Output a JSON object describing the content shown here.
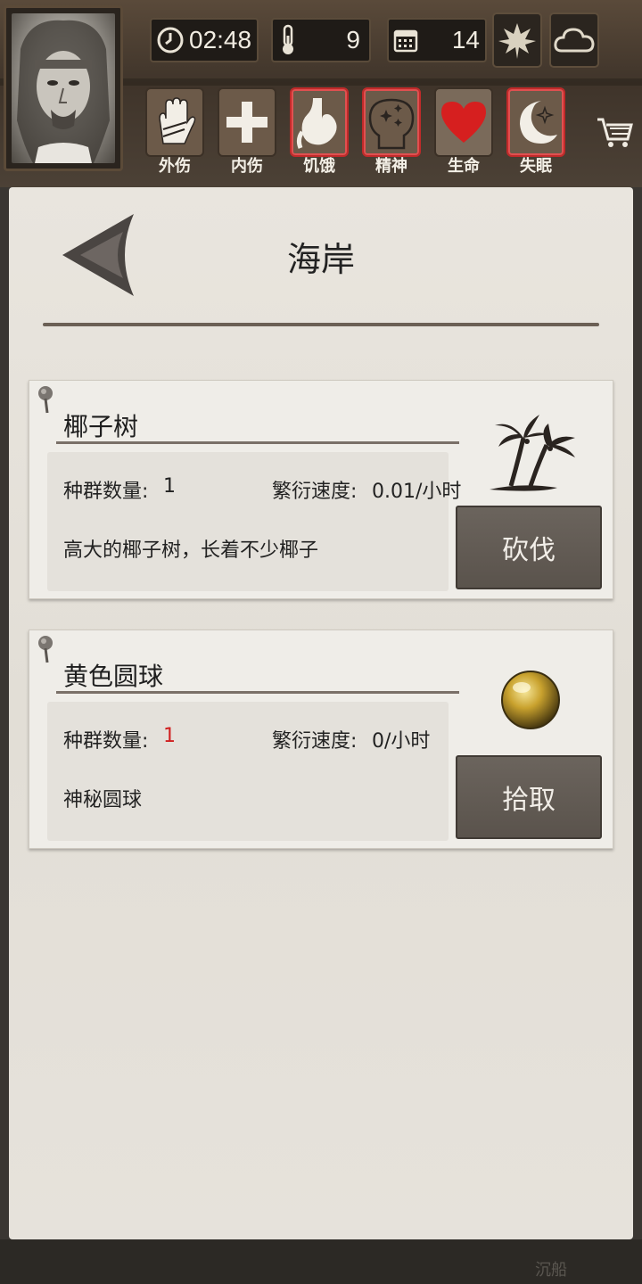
{
  "hud": {
    "time": "02:48",
    "temperature": "9",
    "day": "14"
  },
  "status": [
    {
      "label": "外伤",
      "icon": "hand-icon",
      "alert": false
    },
    {
      "label": "内伤",
      "icon": "cross-icon",
      "alert": false
    },
    {
      "label": "饥饿",
      "icon": "stomach-icon",
      "alert": true
    },
    {
      "label": "精神",
      "icon": "head-sparkle-icon",
      "alert": true
    },
    {
      "label": "生命",
      "icon": "heart-icon",
      "alert": false
    },
    {
      "label": "失眠",
      "icon": "moon-star-icon",
      "alert": true
    }
  ],
  "page": {
    "title": "海岸"
  },
  "resources": [
    {
      "name": "椰子树",
      "population_label": "种群数量:",
      "population_value": "1",
      "growth_label": "繁衍速度:",
      "growth_value": "0.01/小时",
      "description": "高大的椰子树，长着不少椰子",
      "action": "砍伐",
      "icon": "palm-tree-icon"
    },
    {
      "name": "黄色圆球",
      "population_label": "种群数量:",
      "population_value": "1",
      "growth_label": "繁衍速度:",
      "growth_value": "0/小时",
      "description": "神秘圆球",
      "action": "拾取",
      "icon": "yellow-orb-icon"
    }
  ],
  "footer": {
    "text": "沉船"
  },
  "colors": {
    "alert_border": "#c02a2a",
    "population_highlight": "#d02020",
    "heart": "#d61f1f"
  }
}
